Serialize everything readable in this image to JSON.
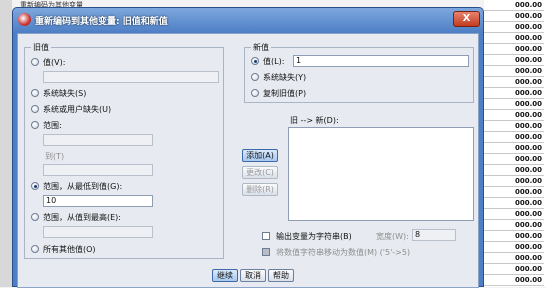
{
  "background": {
    "column_values": [
      "000.00",
      "000.00",
      "000.00",
      "000.00",
      "000.00",
      "000.00",
      "000.00",
      "000.00",
      "000.00",
      "000.00",
      "000.00",
      "000.00",
      "000.00",
      "000.00",
      "000.00",
      "000.00",
      "000.00",
      "000.00",
      "000.00",
      "000.00",
      "000.00",
      "000.00",
      "000.00",
      "000.00",
      "000.00",
      "000.00"
    ],
    "header_fragment": "重新编码为其他变量"
  },
  "dialog": {
    "title": "重新编码到其他变量: 旧值和新值",
    "close_glyph": "X"
  },
  "old_value": {
    "legend": "旧值",
    "value_label": "值(V):",
    "value_input": "",
    "system_missing": "系统缺失(S)",
    "system_or_user_missing": "系统或用户缺失(U)",
    "range_label": "范围:",
    "range_from": "",
    "to_label": "到(T)",
    "range_to": "",
    "lowest_through_label": "范围，从最低到值(G):",
    "lowest_through_value": "10",
    "through_highest_label": "范围，从值到最高(E):",
    "through_highest_value": "",
    "all_other_values": "所有其他值(O)"
  },
  "new_value": {
    "legend": "新值",
    "value_label": "值(L):",
    "value_input": "1",
    "system_missing": "系统缺失(Y)",
    "copy_old_values": "复制旧值(P)"
  },
  "mapping": {
    "label": "旧 --> 新(D):",
    "add_button": "添加(A)",
    "change_button": "更改(C)",
    "remove_button": "删除(R)"
  },
  "options": {
    "output_as_string": "输出变量为字符串(B)",
    "width_label": "宽度(W):",
    "width_value": "8",
    "convert_numeric": "将数值字符串移动为数值(M) ('5'->5)"
  },
  "footer": {
    "continue": "继续",
    "cancel": "取消",
    "help": "帮助"
  }
}
